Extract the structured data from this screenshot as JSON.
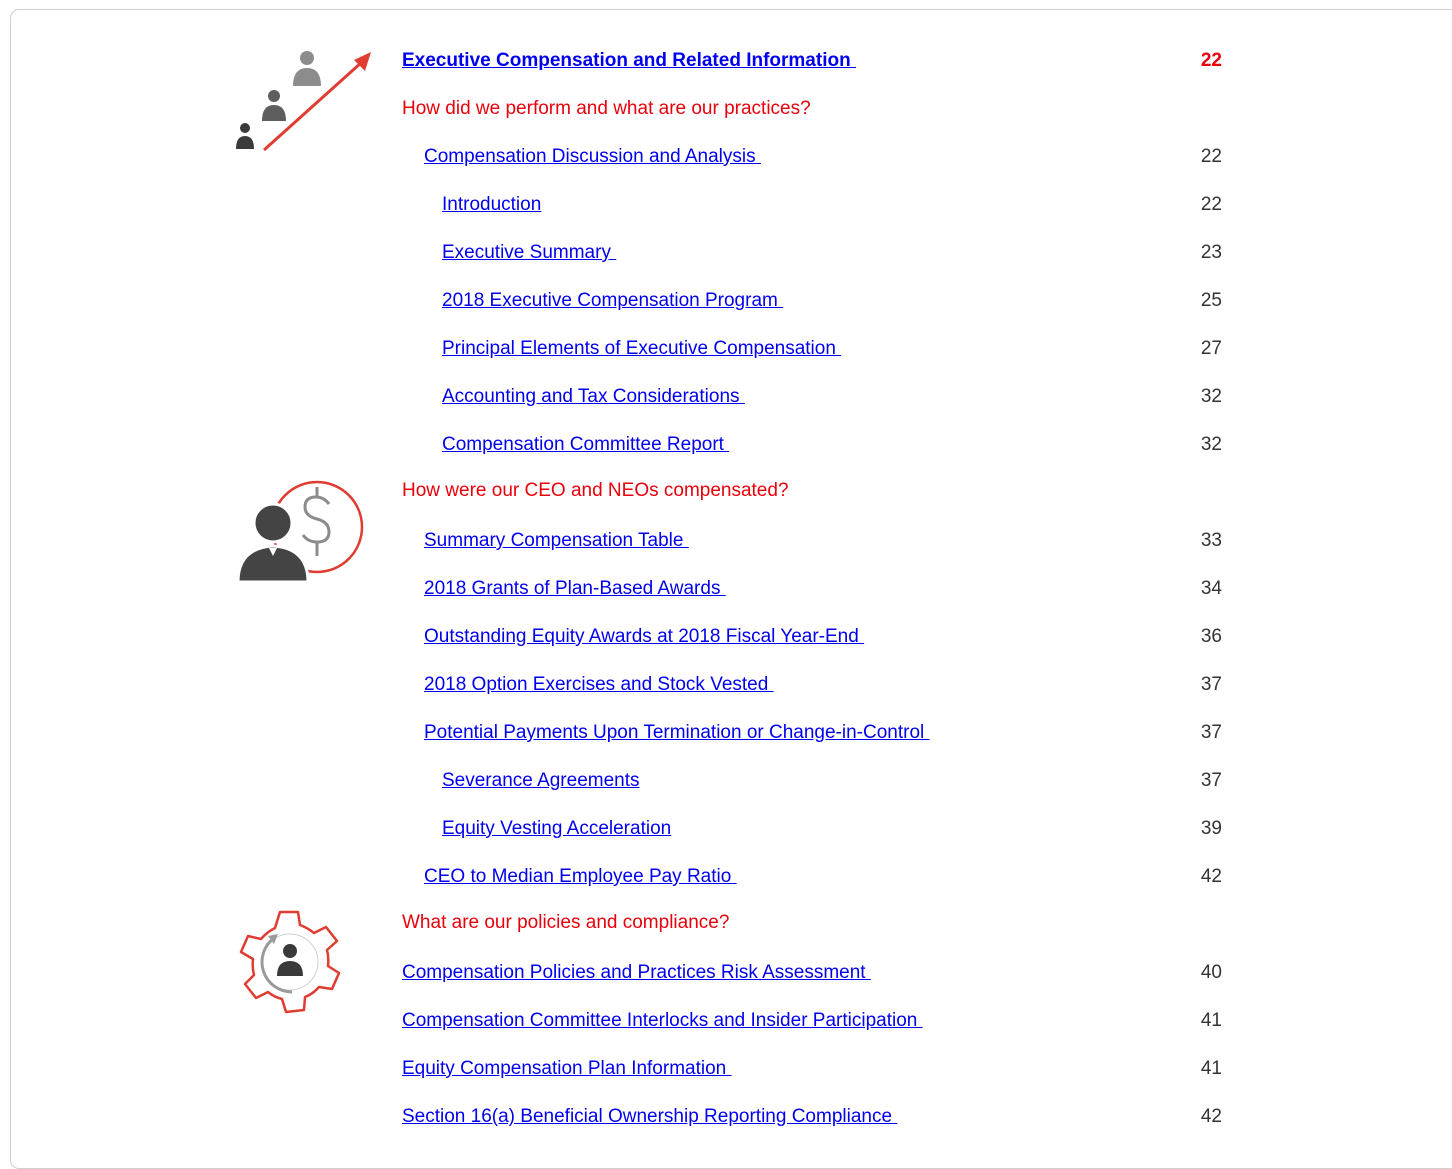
{
  "colors": {
    "link": "#0000ee",
    "question": "#e8000b",
    "page_number": "#333333",
    "icon_gray": "#4a4a4a",
    "icon_light_gray": "#8c8c8c",
    "icon_red": "#e03c31"
  },
  "icons": {
    "growth": "people-growth-arrow-icon",
    "pay": "person-dollar-icon",
    "policy": "gear-person-icon"
  },
  "toc": {
    "header": {
      "label": "Executive Compensation and Related Information ",
      "page": "22"
    },
    "q1": "How did we perform and what are our practices?",
    "cda": {
      "label": "Compensation Discussion and Analysis ",
      "page": "22"
    },
    "cda_items": [
      {
        "label": "Introduction",
        "page": "22"
      },
      {
        "label": "Executive Summary ",
        "page": "23"
      },
      {
        "label": "2018 Executive Compensation Program ",
        "page": "25"
      },
      {
        "label": "Principal Elements of Executive Compensation ",
        "page": "27"
      },
      {
        "label": "Accounting and Tax Considerations ",
        "page": "32"
      },
      {
        "label": "Compensation Committee Report ",
        "page": "32"
      }
    ],
    "q2": "How were our CEO and NEOs compensated?",
    "pay_items": [
      {
        "label": "Summary Compensation Table ",
        "page": "33"
      },
      {
        "label": "2018 Grants of Plan-Based Awards ",
        "page": "34"
      },
      {
        "label": "Outstanding Equity Awards at 2018 Fiscal Year-End ",
        "page": "36"
      },
      {
        "label": "2018 Option Exercises and Stock Vested ",
        "page": "37"
      },
      {
        "label": "Potential Payments Upon Termination or Change-in-Control ",
        "page": "37"
      }
    ],
    "termination_items": [
      {
        "label": "Severance Agreements",
        "page": "37"
      },
      {
        "label": "Equity Vesting Acceleration",
        "page": "39"
      }
    ],
    "pay_ratio": {
      "label": "CEO to Median Employee Pay Ratio ",
      "page": "42"
    },
    "q3": "What are our policies and compliance?",
    "policy_items": [
      {
        "label": "Compensation Policies and Practices Risk Assessment ",
        "page": "40"
      },
      {
        "label": "Compensation Committee Interlocks and Insider Participation ",
        "page": "41"
      },
      {
        "label": "Equity Compensation Plan Information ",
        "page": "41"
      },
      {
        "label": "Section 16(a) Beneficial Ownership Reporting Compliance ",
        "page": "42"
      }
    ]
  }
}
